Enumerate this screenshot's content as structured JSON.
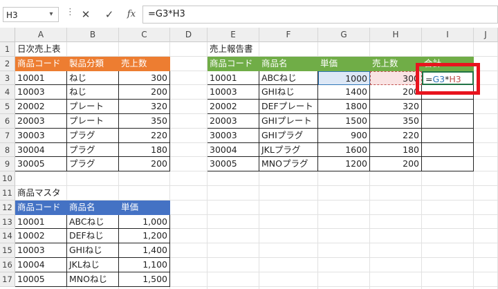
{
  "formula_bar": {
    "name_box": "H3",
    "cancel_icon": "✕",
    "enter_icon": "✓",
    "fx_label": "fx",
    "formula": "=G3*H3"
  },
  "columns": [
    "A",
    "B",
    "C",
    "D",
    "E",
    "F",
    "G",
    "H",
    "I",
    "J"
  ],
  "rows": [
    "1",
    "2",
    "3",
    "4",
    "5",
    "6",
    "7",
    "8",
    "9",
    "10",
    "11",
    "12",
    "13",
    "14",
    "15",
    "16",
    "17"
  ],
  "daily_sales": {
    "title": "日次売上表",
    "headers": [
      "商品コード",
      "製品分類",
      "売上数"
    ],
    "rows": [
      [
        "10001",
        "ねじ",
        "300"
      ],
      [
        "10003",
        "ねじ",
        "200"
      ],
      [
        "20002",
        "プレート",
        "320"
      ],
      [
        "20003",
        "プレート",
        "350"
      ],
      [
        "30003",
        "プラグ",
        "220"
      ],
      [
        "30004",
        "プラグ",
        "180"
      ],
      [
        "30005",
        "プラグ",
        "200"
      ]
    ]
  },
  "sales_report": {
    "title": "売上報告書",
    "headers": [
      "商品コード",
      "商品名",
      "単価",
      "売上数",
      "合計"
    ],
    "rows": [
      [
        "10001",
        "ABCねじ",
        "1000",
        "300"
      ],
      [
        "10003",
        "GHIねじ",
        "1400",
        "200"
      ],
      [
        "20002",
        "DEFプレート",
        "1800",
        "320"
      ],
      [
        "20003",
        "GHIプレート",
        "1500",
        "350"
      ],
      [
        "30003",
        "GHIプラグ",
        "900",
        "220"
      ],
      [
        "30004",
        "JKLプラグ",
        "1600",
        "180"
      ],
      [
        "30005",
        "MNOプラグ",
        "1200",
        "200"
      ]
    ],
    "editing_cell": {
      "ref_g": "G3",
      "op": "*",
      "ref_h": "H3",
      "eq": "="
    }
  },
  "product_master": {
    "title": "商品マスタ",
    "headers": [
      "商品コード",
      "商品名",
      "単価"
    ],
    "rows": [
      [
        "10001",
        "ABCねじ",
        "1,000"
      ],
      [
        "10002",
        "DEFねじ",
        "1,200"
      ],
      [
        "10003",
        "GHIねじ",
        "1,400"
      ],
      [
        "10004",
        "JKLねじ",
        "1,100"
      ],
      [
        "10005",
        "MNOねじ",
        "1,500"
      ]
    ]
  },
  "colors": {
    "orange": "#ed7d31",
    "green": "#70ad47",
    "blue": "#4472c4",
    "highlight_red": "#e8141e",
    "ref_blue": "#2e75b6",
    "ref_red": "#c0504d"
  }
}
